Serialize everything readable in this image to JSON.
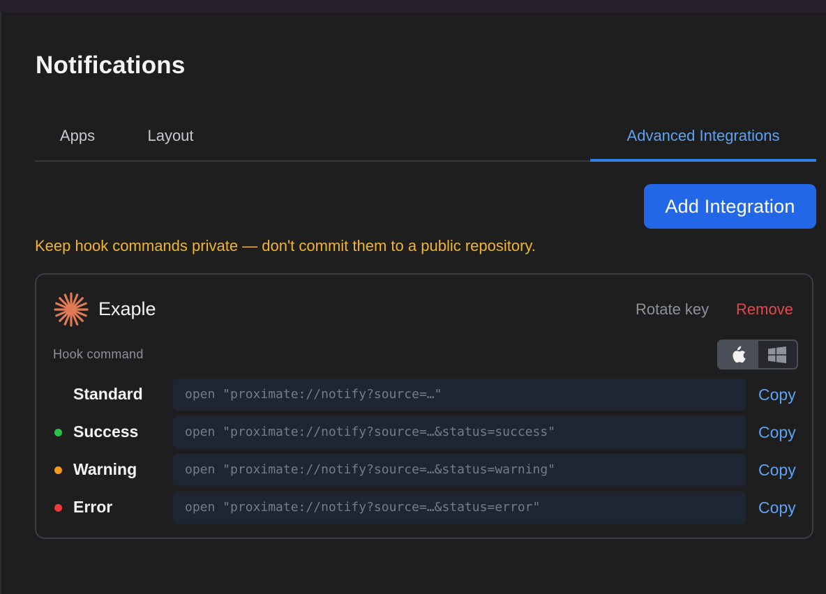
{
  "page": {
    "title": "Notifications"
  },
  "tabs": [
    {
      "label": "Apps",
      "active": false
    },
    {
      "label": "Layout",
      "active": false
    },
    {
      "label": "Advanced Integrations",
      "active": true
    }
  ],
  "actions": {
    "add_integration_label": "Add Integration"
  },
  "warning": "Keep hook commands private — don't commit them to a public repository.",
  "integration": {
    "name": "Exaple",
    "logo_icon": "asterisk-burst-icon",
    "rotate_key_label": "Rotate key",
    "remove_label": "Remove",
    "hook_command_label": "Hook command",
    "os_toggle": {
      "options": [
        {
          "icon": "apple-icon",
          "selected": true
        },
        {
          "icon": "windows-icon",
          "selected": false
        }
      ]
    },
    "commands": [
      {
        "label": "Standard",
        "status_color": null,
        "command": "open \"proximate://notify?source=…\"",
        "copy_label": "Copy"
      },
      {
        "label": "Success",
        "status_color": "#2bc24a",
        "command": "open \"proximate://notify?source=…&status=success\"",
        "copy_label": "Copy"
      },
      {
        "label": "Warning",
        "status_color": "#f39a1c",
        "command": "open \"proximate://notify?source=…&status=warning\"",
        "copy_label": "Copy"
      },
      {
        "label": "Error",
        "status_color": "#ec3a3a",
        "command": "open \"proximate://notify?source=…&status=error\"",
        "copy_label": "Copy"
      }
    ]
  },
  "colors": {
    "accent": "#2167e8",
    "link": "#5ea2f2",
    "warning_text": "#f0b52a",
    "danger": "#e5484d",
    "logo": "#e07a55"
  }
}
